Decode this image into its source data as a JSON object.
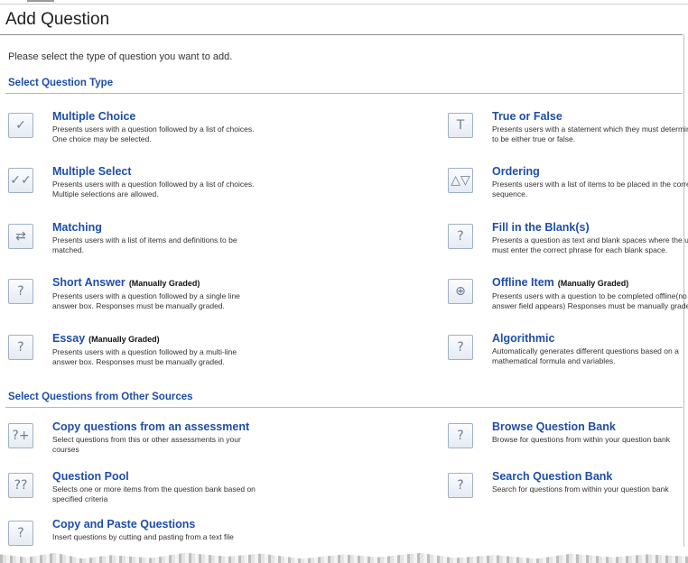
{
  "page": {
    "title": "Add Question",
    "instructions": "Please select the type of question you want to add."
  },
  "sections": {
    "question_type": "Select Question Type",
    "other_sources": "Select Questions from Other Sources"
  },
  "question_types": [
    {
      "title": "Multiple Choice",
      "badge": "",
      "desc": "Presents users with a question followed by a list of choices. One choice may be selected.",
      "icon": "checkmark-icon"
    },
    {
      "title": "True or False",
      "badge": "",
      "desc": "Presents users with a statement which they must determine to be either true or false.",
      "icon": "true-false-icon"
    },
    {
      "title": "Multiple Select",
      "badge": "",
      "desc": "Presents users with a question followed by a list of choices. Multiple selections are allowed.",
      "icon": "double-checkmark-icon"
    },
    {
      "title": "Ordering",
      "badge": "",
      "desc": "Presents users with a list of items to be placed in the correct sequence.",
      "icon": "ordering-icon"
    },
    {
      "title": "Matching",
      "badge": "",
      "desc": "Presents users with a list of items and definitions to be matched.",
      "icon": "matching-icon"
    },
    {
      "title": "Fill in the Blank(s)",
      "badge": "",
      "desc": "Presents a question as text and blank spaces where the user must enter the correct phrase for each blank space.",
      "icon": "fill-blank-icon"
    },
    {
      "title": "Short Answer",
      "badge": "(Manually Graded)",
      "desc": "Presents users with a question followed by a single line answer box. Responses must be manually graded.",
      "icon": "short-answer-icon"
    },
    {
      "title": "Offline Item",
      "badge": "(Manually Graded)",
      "desc": "Presents users with a question to be completed offline(no answer field appears) Responses must be manually graded.",
      "icon": "offline-item-icon"
    },
    {
      "title": "Essay",
      "badge": "(Manually Graded)",
      "desc": "Presents users with a question followed by a multi-line answer box. Responses must be manually graded.",
      "icon": "essay-icon"
    },
    {
      "title": "Algorithmic",
      "badge": "",
      "desc": "Automatically generates different questions based on a mathematical formula and variables.",
      "icon": "algorithmic-icon"
    }
  ],
  "other_sources": [
    {
      "title": "Copy questions from an assessment",
      "desc": "Select questions from this or other assessments in your courses",
      "icon": "copy-assessment-icon"
    },
    {
      "title": "Browse Question Bank",
      "desc": "Browse for questions from within your question bank",
      "icon": "browse-bank-icon"
    },
    {
      "title": "Question Pool",
      "desc": "Selects one or more items from the question bank based on specified criteria",
      "icon": "question-pool-icon"
    },
    {
      "title": "Search Question Bank",
      "desc": "Search for questions from within your question bank",
      "icon": "search-bank-icon"
    },
    {
      "title": "Copy and Paste Questions",
      "desc": "Insert questions by cutting and pasting from a text file",
      "icon": "copy-paste-icon"
    }
  ]
}
